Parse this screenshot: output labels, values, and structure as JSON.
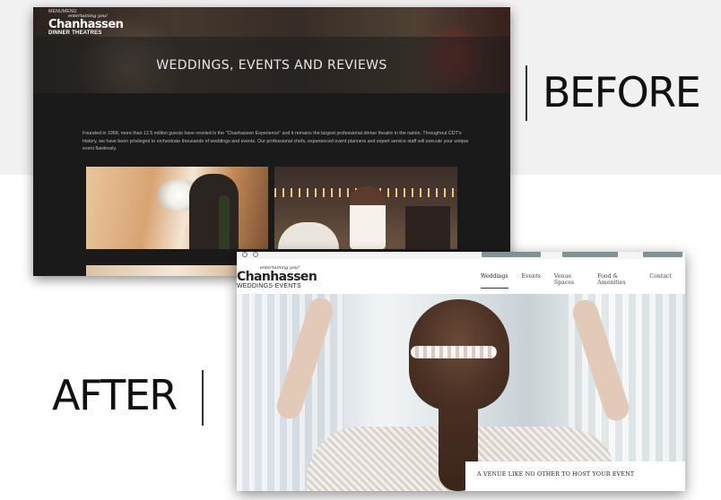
{
  "before": {
    "label": "BEFORE",
    "menu": "MENUMENU",
    "logo": {
      "tagline": "entertaining you!",
      "name": "Chanhassen",
      "sub": "DINNER THEATRES"
    },
    "title": "WEDDINGS, EVENTS AND REVIEWS",
    "intro": "Founded in 1968, more than 12.5 million guests have reveled in the \"Chanhassen Experience\" and it remains the largest professional dinner theatre in the nation. Throughout CDT's history, we have been privileged to orchestrate thousands of weddings and events. Our professional chefs, experienced event planners and expert service staff will execute your unique event flawlessly."
  },
  "after": {
    "label": "AFTER",
    "logo": {
      "tagline": "entertaining you!",
      "name": "Chanhassen",
      "sub": "WEDDINGS-EVENTS"
    },
    "nav": [
      {
        "label": "Weddings",
        "active": true
      },
      {
        "label": "Events",
        "active": false
      },
      {
        "label": "Venue Spaces",
        "active": false
      },
      {
        "label": "Food & Amenities",
        "active": false
      },
      {
        "label": "Contact",
        "active": false
      }
    ],
    "caption": "A VENUE LIKE NO OTHER TO HOST YOUR EVENT",
    "button_color": "#7f9294"
  },
  "colors": {
    "before_bg": "#1a1a1a",
    "band_bg": "#f1f1f1"
  }
}
